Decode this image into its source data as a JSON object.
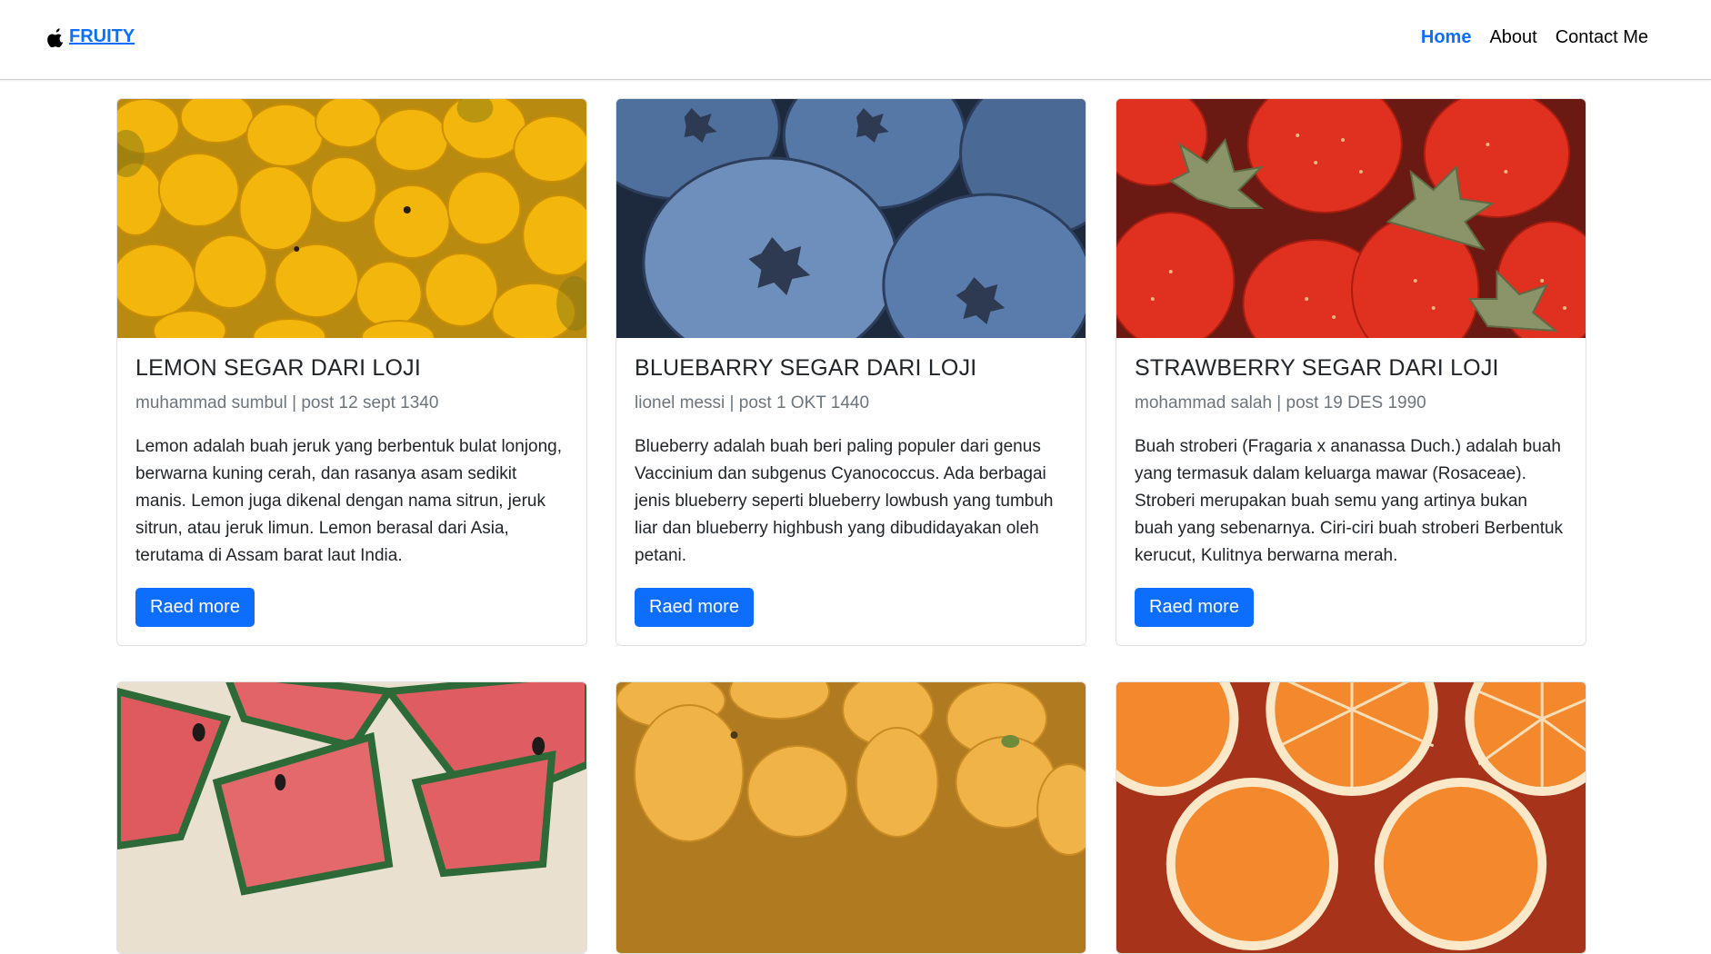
{
  "navbar": {
    "brand": " FRUITY",
    "links": [
      {
        "label": "Home",
        "active": true
      },
      {
        "label": "About",
        "active": false
      },
      {
        "label": "Contact Me",
        "active": false
      }
    ]
  },
  "cards": [
    {
      "title": "LEMON SEGAR DARI LOJI",
      "subtitle": "muhammad sumbul | post 12 sept 1340",
      "text": "Lemon adalah buah jeruk yang berbentuk bulat lonjong, berwarna kuning cerah, dan rasanya asam sedikit manis. Lemon juga dikenal dengan nama sitrun, jeruk sitrun, atau jeruk limun. Lemon berasal dari Asia, terutama di Assam barat laut India.",
      "button": "Raed more"
    },
    {
      "title": "BLUEBARRY SEGAR DARI LOJI",
      "subtitle": "lionel messi | post 1 OKT 1440",
      "text": "Blueberry adalah buah beri paling populer dari genus Vaccinium dan subgenus Cyanococcus. Ada berbagai jenis blueberry seperti blueberry lowbush yang tumbuh liar dan blueberry highbush yang dibudidayakan oleh petani.",
      "button": "Raed more"
    },
    {
      "title": "STRAWBERRY SEGAR DARI LOJI",
      "subtitle": "mohammad salah | post 19 DES 1990",
      "text": "Buah stroberi (Fragaria x ananassa Duch.) adalah buah yang termasuk dalam keluarga mawar (Rosaceae). Stroberi merupakan buah semu yang artinya bukan buah yang sebenarnya. Ciri-ciri buah stroberi Berbentuk kerucut, Kulitnya berwarna merah.",
      "button": "Raed more"
    }
  ],
  "colors": {
    "primary": "#0d6efd",
    "muted": "#6c757d",
    "text": "#212529"
  },
  "icons": {
    "brand": "apple-icon"
  }
}
